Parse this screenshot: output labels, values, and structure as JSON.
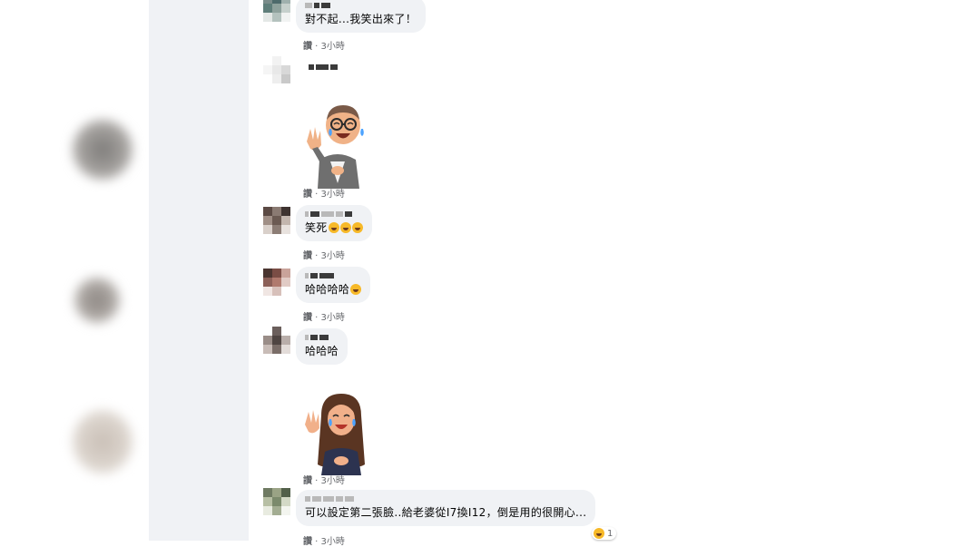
{
  "comments": [
    {
      "text": "對不起...我笑出來了！",
      "meta": {
        "like": "讚",
        "sep": " · ",
        "time": "3小時"
      }
    },
    {
      "sticker": "laughing-man-avatar",
      "meta": {
        "like": "讚",
        "sep": " · ",
        "time": "3小時"
      }
    },
    {
      "text": "笑死",
      "emoji": "rofl",
      "meta": {
        "like": "讚",
        "sep": " · ",
        "time": "3小時"
      }
    },
    {
      "text": "哈哈哈哈",
      "emoji": "laughing",
      "meta": {
        "like": "讚",
        "sep": " · ",
        "time": "3小時"
      }
    },
    {
      "text": "哈哈哈"
    },
    {
      "sticker": "laughing-woman-avatar",
      "meta": {
        "like": "讚",
        "sep": " · ",
        "time": "3小時"
      }
    },
    {
      "text": "可以設定第二張臉..給老婆從I7換I12，倒是用的很開心...",
      "reactions": {
        "icon": "haha-reaction",
        "count": "1"
      },
      "meta": {
        "like": "讚",
        "sep": " · ",
        "time": "3小時"
      }
    }
  ],
  "colors": {
    "bubble": "#f0f2f5",
    "meta": "#65676b",
    "emoji": "#f7b928"
  }
}
